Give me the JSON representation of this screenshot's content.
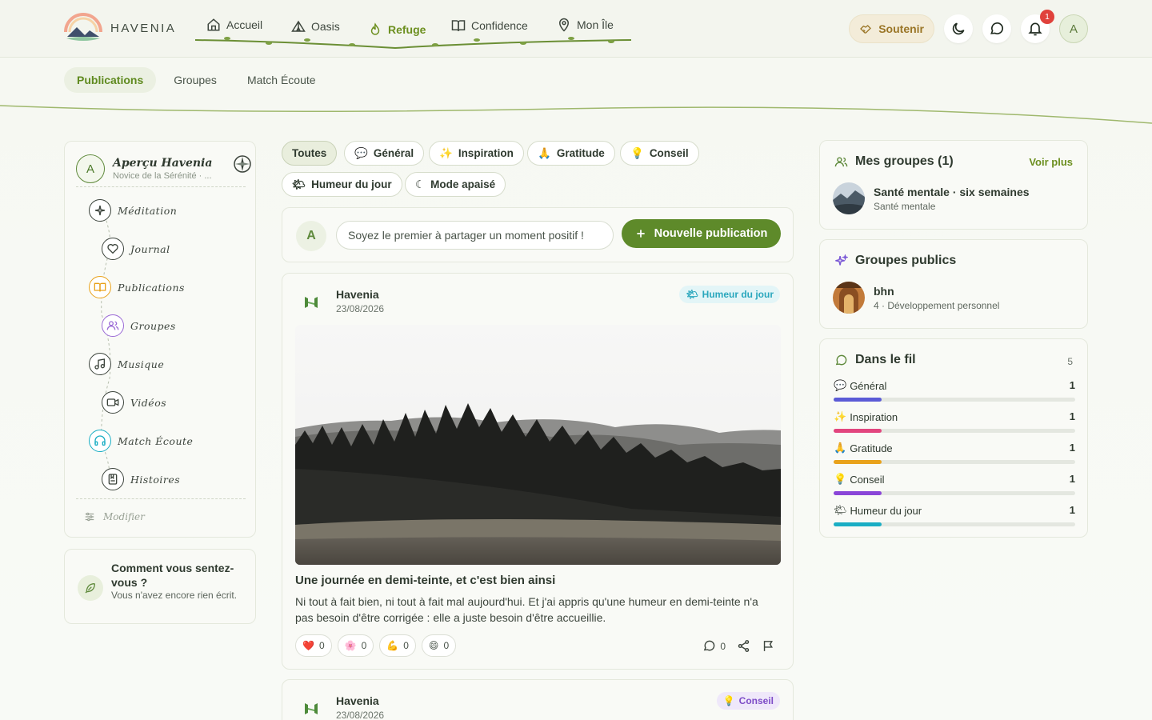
{
  "brand": {
    "name": "HAVENIA"
  },
  "nav": {
    "items": [
      {
        "label": "Accueil",
        "icon": "home-icon"
      },
      {
        "label": "Oasis",
        "icon": "tent-icon"
      },
      {
        "label": "Refuge",
        "icon": "flame-icon",
        "active": true
      },
      {
        "label": "Confidence",
        "icon": "book-icon"
      },
      {
        "label": "Mon Île",
        "icon": "map-pin-icon"
      }
    ],
    "support_label": "Soutenir",
    "notification_count": "1",
    "avatar_initial": "A"
  },
  "subtabs": [
    {
      "label": "Publications",
      "active": true
    },
    {
      "label": "Groupes"
    },
    {
      "label": "Match Écoute"
    }
  ],
  "sidebar": {
    "avatar_initial": "A",
    "title": "Aperçu Havenia",
    "subtitle": "Novice de la Sérénité · ...",
    "items": [
      {
        "label": "Méditation",
        "icon": "sparkle-icon"
      },
      {
        "label": "Journal",
        "icon": "heart-icon"
      },
      {
        "label": "Publications",
        "icon": "open-book-icon"
      },
      {
        "label": "Groupes",
        "icon": "users-icon"
      },
      {
        "label": "Musique",
        "icon": "music-icon"
      },
      {
        "label": "Vidéos",
        "icon": "video-icon"
      },
      {
        "label": "Match Écoute",
        "icon": "headphones-icon"
      },
      {
        "label": "Histoires",
        "icon": "book-bookmark-icon"
      }
    ],
    "modify_label": "Modifier"
  },
  "mood": {
    "title": "Comment vous sentez-vous ?",
    "subtitle": "Vous n'avez encore rien écrit."
  },
  "filters": [
    {
      "label": "Toutes",
      "emoji": "",
      "active": true
    },
    {
      "label": "Général",
      "emoji": "💬"
    },
    {
      "label": "Inspiration",
      "emoji": "✨"
    },
    {
      "label": "Gratitude",
      "emoji": "🙏"
    },
    {
      "label": "Conseil",
      "emoji": "💡"
    },
    {
      "label": "Humeur du jour",
      "emoji": "🌤"
    },
    {
      "label": "Mode apaisé",
      "emoji": "☾"
    }
  ],
  "composer": {
    "avatar_initial": "A",
    "placeholder": "Soyez le premier à partager un moment positif !",
    "button_label": "Nouvelle publication"
  },
  "posts": [
    {
      "author": "Havenia",
      "date": "23/08/2026",
      "tag": "Humeur du jour",
      "tag_emoji": "🌤",
      "title": "Une journée en demi-teinte, et c'est bien ainsi",
      "body": "Ni tout à fait bien, ni tout à fait mal aujourd'hui. Et j'ai appris qu'une humeur en demi-teinte n'a pas besoin d'être corrigée : elle a juste besoin d'être accueillie.",
      "reactions": [
        {
          "emoji": "❤️",
          "count": "0"
        },
        {
          "emoji": "🌸",
          "count": "0"
        },
        {
          "emoji": "💪",
          "count": "0"
        },
        {
          "emoji": "😄",
          "count": "0"
        }
      ],
      "comments": "0"
    },
    {
      "author": "Havenia",
      "date": "23/08/2026",
      "tag": "Conseil",
      "tag_emoji": "💡"
    }
  ],
  "my_groups": {
    "title": "Mes groupes (1)",
    "see_more": "Voir plus",
    "items": [
      {
        "name": "Santé mentale · six semaines",
        "sub": "Santé mentale"
      }
    ]
  },
  "public_groups": {
    "title": "Groupes publics",
    "items": [
      {
        "name": "bhn",
        "sub": "4 · Développement personnel"
      }
    ]
  },
  "feed": {
    "title": "Dans le fil",
    "total": "5",
    "items": [
      {
        "emoji": "💬",
        "label": "Général",
        "count": "1",
        "color": "#5b5bd6"
      },
      {
        "emoji": "✨",
        "label": "Inspiration",
        "count": "1",
        "color": "#e2457e"
      },
      {
        "emoji": "🙏",
        "label": "Gratitude",
        "count": "1",
        "color": "#e9a21b"
      },
      {
        "emoji": "💡",
        "label": "Conseil",
        "count": "1",
        "color": "#8a45d8"
      },
      {
        "emoji": "🌤",
        "label": "Humeur du jour",
        "count": "1",
        "color": "#1aaec4"
      }
    ]
  },
  "colors": {
    "accent": "#5e8a2a",
    "active_nav": "#6c8f1f",
    "support": "#9a7526",
    "notification": "#e0413b"
  }
}
